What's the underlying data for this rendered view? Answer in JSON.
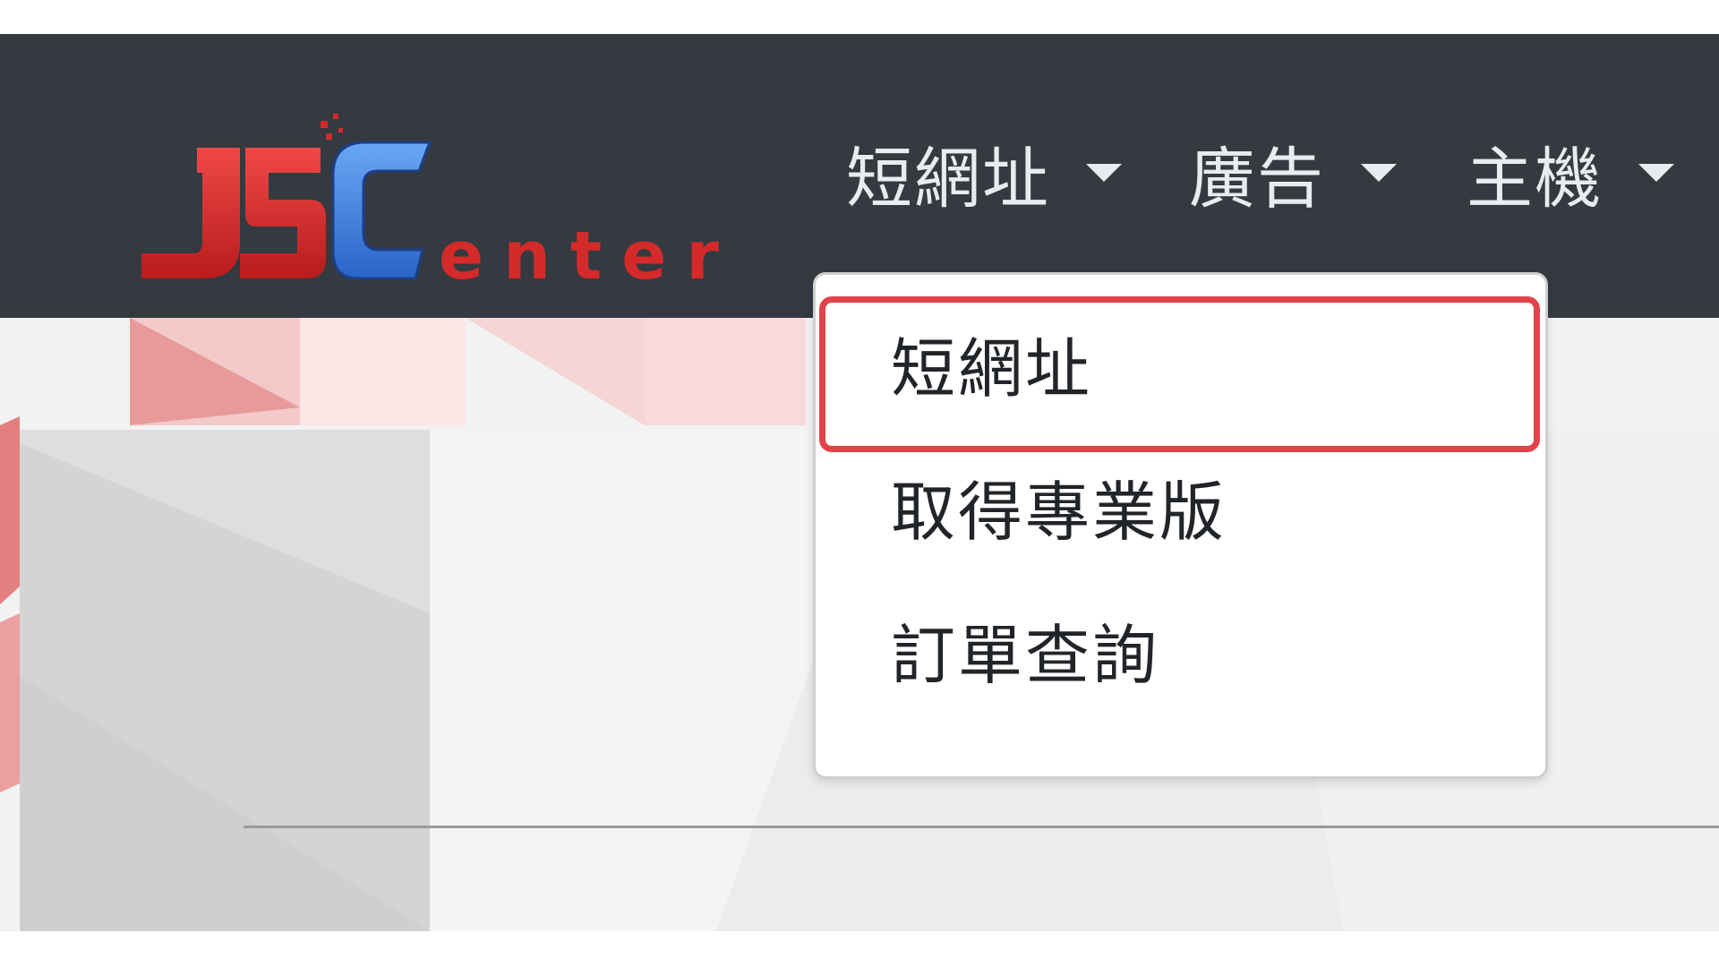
{
  "brand": {
    "logo_text": "JSCenter",
    "logo_colors": {
      "red": "#d42a2a",
      "blue": "#3c7fe0"
    }
  },
  "navbar": {
    "background": "#343a40",
    "items": [
      {
        "label": "短網址",
        "icon": "caret-down-icon"
      },
      {
        "label": "廣告",
        "icon": "caret-down-icon"
      },
      {
        "label": "主機",
        "icon": "caret-down-icon"
      }
    ]
  },
  "dropdown": {
    "parent": "短網址",
    "highlight_color": "#e2434b",
    "items": [
      {
        "label": "短網址",
        "highlighted": true
      },
      {
        "label": "取得專業版",
        "highlighted": false
      },
      {
        "label": "訂單查詢",
        "highlighted": false
      }
    ]
  }
}
